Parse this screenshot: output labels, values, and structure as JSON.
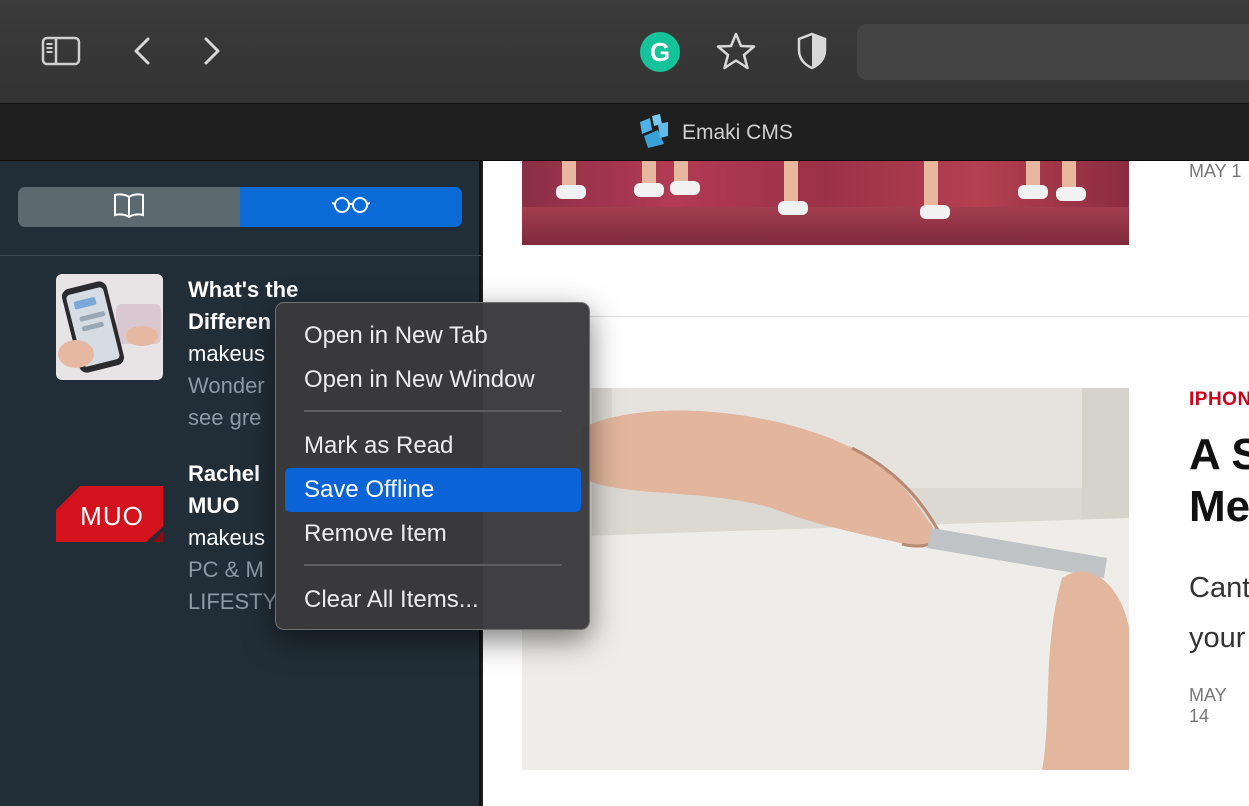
{
  "toolbar": {
    "sidebar_icon": "sidebar-icon",
    "back_icon": "chevron-left-icon",
    "forward_icon": "chevron-right-icon",
    "grammarly_glyph": "G",
    "bookmark_icon": "star-icon",
    "privacy_icon": "shield-icon"
  },
  "tab": {
    "title": "Emaki CMS"
  },
  "sidebar": {
    "segments": [
      {
        "icon": "book-icon",
        "selected": false
      },
      {
        "icon": "glasses-icon",
        "selected": true
      }
    ],
    "items": [
      {
        "title_1": "What's the",
        "title_2": "Differen",
        "domain": "makeus",
        "desc_1": "Wonder",
        "desc_2": "see gre"
      },
      {
        "title_1": "Rachel",
        "title_2": "MUO",
        "domain": "makeus",
        "desc_1": "PC & M",
        "desc_2": "LIFESTY",
        "logo_text": "MUO"
      }
    ]
  },
  "content": {
    "top_date": "MAY 1",
    "category": "IPHON",
    "headline_1": "A S",
    "headline_2": "Me",
    "excerpt_1": "Cant",
    "excerpt_2": "your",
    "date": "MAY 14"
  },
  "menu": {
    "items": [
      "Open in New Tab",
      "Open in New Window",
      "Mark as Read",
      "Save Offline",
      "Remove Item",
      "Clear All Items..."
    ],
    "highlighted": "Save Offline"
  },
  "colors": {
    "accent": "#0a64d7",
    "sidebar_bg": "#212e38",
    "category_red": "#d0021b",
    "grammarly_green": "#15c39a",
    "muo_red": "#d3121d"
  }
}
